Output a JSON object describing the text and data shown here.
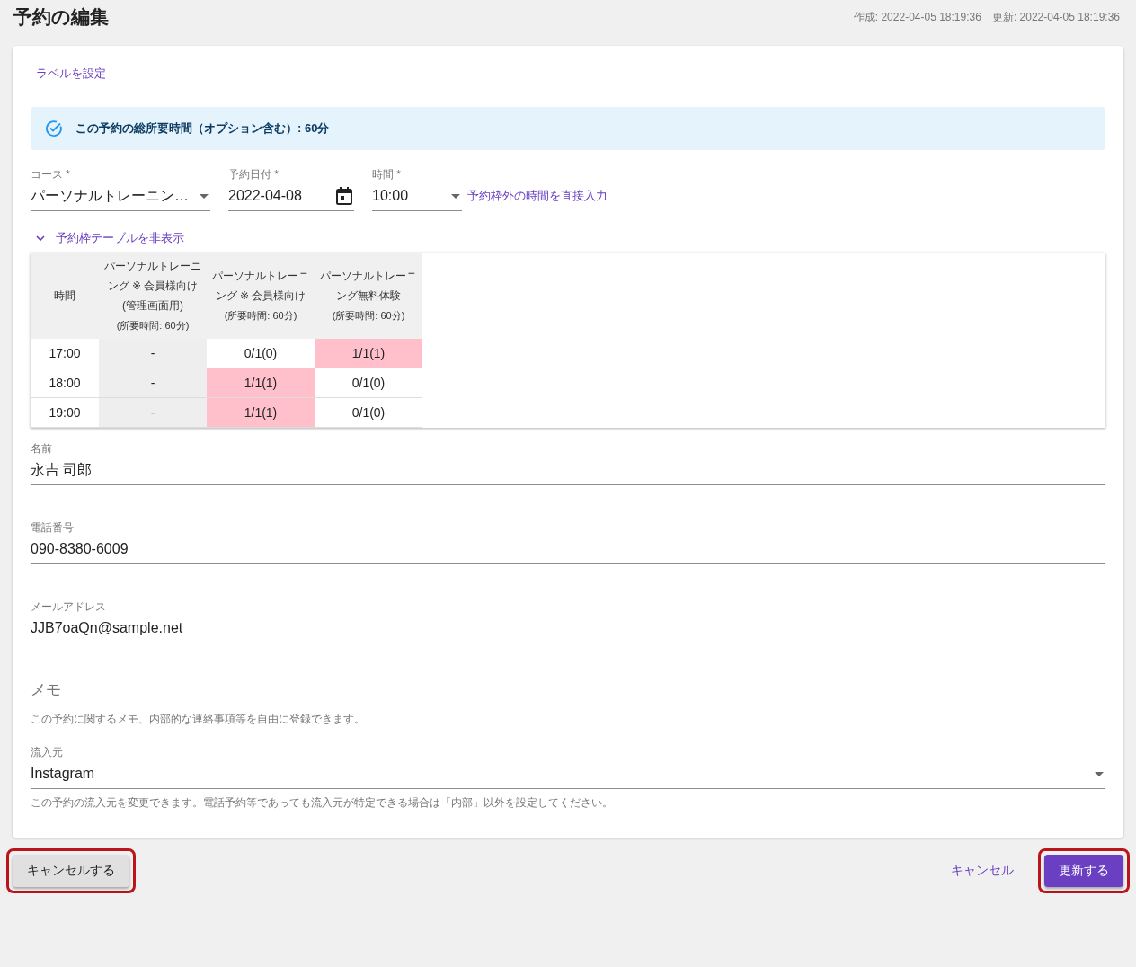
{
  "header": {
    "title": "予約の編集",
    "created": "作成: 2022-04-05 18:19:36",
    "updated": "更新: 2022-04-05 18:19:36"
  },
  "label_link": "ラベルを設定",
  "info_banner": {
    "text": "この予約の総所要時間（オプション含む）: 60分"
  },
  "course": {
    "label": "コース *",
    "value": "パーソナルトレーニン…"
  },
  "date": {
    "label": "予約日付 *",
    "value": "2022-04-08"
  },
  "time": {
    "label": "時間 *",
    "value": "10:00"
  },
  "direct_time_link": "予約枠外の時間を直接入力",
  "slot_table": {
    "toggle": "予約枠テーブルを非表示",
    "expanded": true,
    "time_header": "時間",
    "columns": [
      {
        "name": "パーソナルトレーニング ※ 会員様向け (管理画面用)",
        "duration": "(所要時間: 60分)"
      },
      {
        "name": "パーソナルトレーニング ※ 会員様向け",
        "duration": "(所要時間: 60分)"
      },
      {
        "name": "パーソナルトレーニング無料体験",
        "duration": "(所要時間: 60分)"
      }
    ],
    "rows": [
      {
        "time": "17:00",
        "cells": [
          {
            "text": "-",
            "color": "#eeeeee"
          },
          {
            "text": "0/1(0)",
            "color": "#ffffff"
          },
          {
            "text": "1/1(1)",
            "color": "#ffc0cb"
          }
        ]
      },
      {
        "time": "18:00",
        "cells": [
          {
            "text": "-",
            "color": "#eeeeee"
          },
          {
            "text": "1/1(1)",
            "color": "#ffc0cb"
          },
          {
            "text": "0/1(0)",
            "color": "#ffffff"
          }
        ]
      },
      {
        "time": "19:00",
        "cells": [
          {
            "text": "-",
            "color": "#eeeeee"
          },
          {
            "text": "1/1(1)",
            "color": "#ffc0cb"
          },
          {
            "text": "0/1(0)",
            "color": "#ffffff"
          }
        ]
      }
    ]
  },
  "fields": [
    {
      "label": "名前",
      "value": "永吉 司郎"
    },
    {
      "label": "電話番号",
      "value": "090-8380-6009"
    },
    {
      "label": "メールアドレス",
      "value": "JJB7oaQn@sample.net"
    }
  ],
  "memo": {
    "placeholder": "メモ",
    "helper": "この予約に関するメモ、内部的な連絡事項等を自由に登録できます。"
  },
  "source": {
    "label": "流入元",
    "value": "Instagram",
    "helper": "この予約の流入元を変更できます。電話予約等であっても流入元が特定できる場合は「内部」以外を設定してください。"
  },
  "buttons": [
    {
      "kind": "secondary",
      "label": "キャンセルする",
      "highlighted": true
    },
    {
      "kind": "text",
      "label": "キャンセル",
      "highlighted": false
    },
    {
      "kind": "primary",
      "label": "更新する",
      "highlighted": true
    }
  ]
}
